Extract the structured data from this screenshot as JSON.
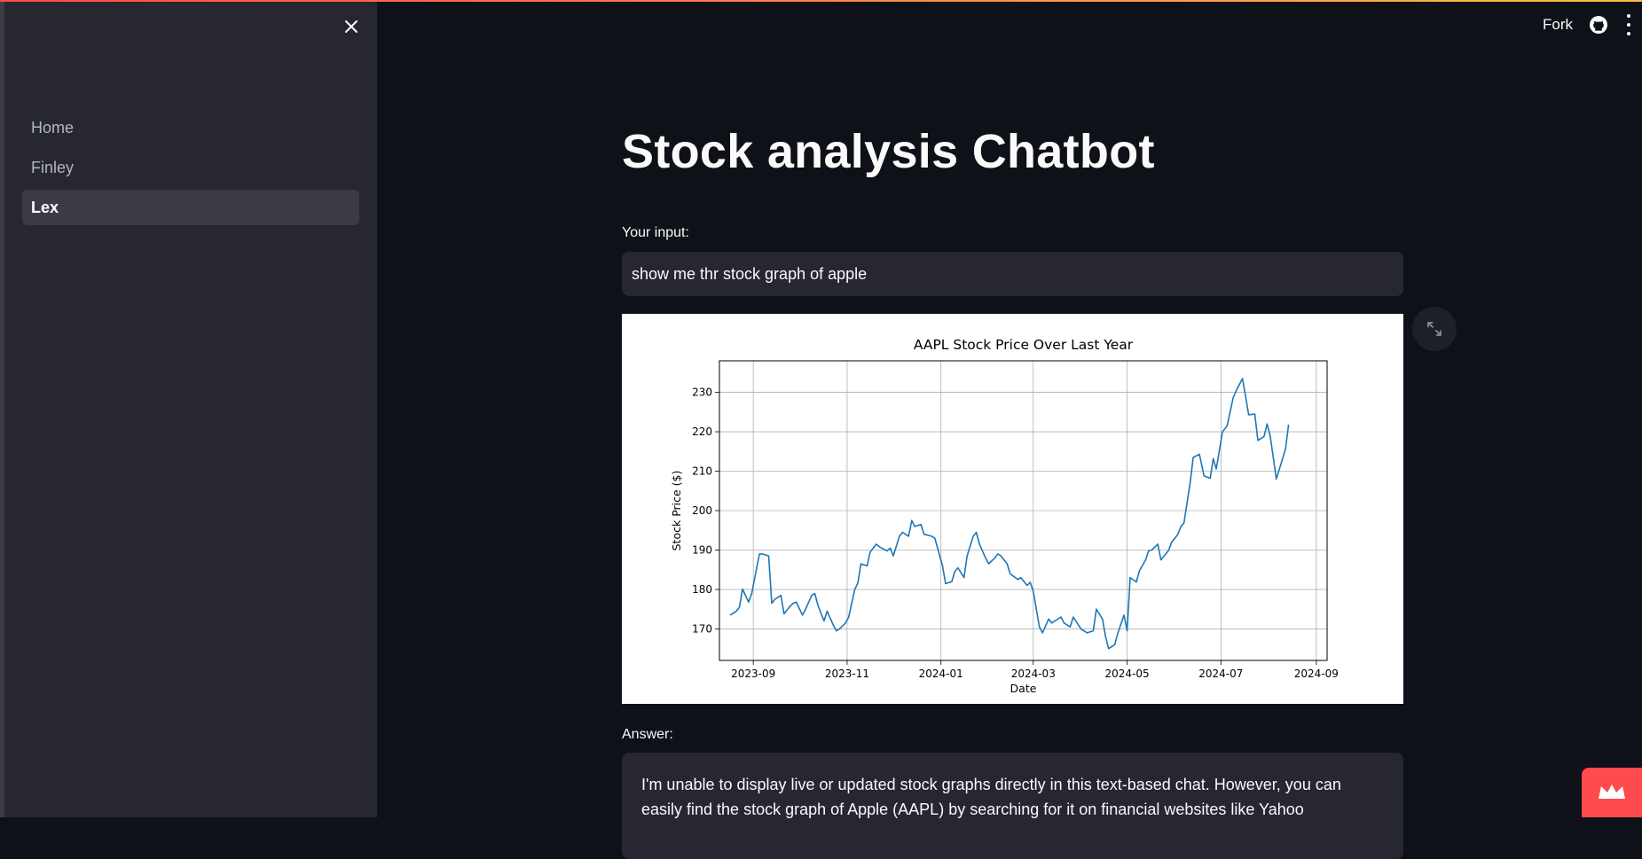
{
  "sidebar": {
    "items": [
      {
        "label": "Home",
        "active": false
      },
      {
        "label": "Finley",
        "active": false
      },
      {
        "label": "Lex",
        "active": true
      }
    ]
  },
  "header": {
    "fork_label": "Fork"
  },
  "main": {
    "title": "Stock analysis Chatbot",
    "input_label": "Your input:",
    "input_value": "show me thr stock graph of apple",
    "answer_label": "Answer:",
    "answer_text": "I'm unable to display live or updated stock graphs directly in this text-based chat. However, you can easily find the stock graph of Apple (AAPL) by searching for it on financial websites like Yahoo"
  },
  "colors": {
    "accent": "#ff4b4b",
    "line": "#1f77b4",
    "sidebar_bg": "#262730",
    "main_bg": "#0e1117"
  },
  "chart_data": {
    "type": "line",
    "title": "AAPL Stock Price Over Last Year",
    "xlabel": "Date",
    "ylabel": "Stock Price ($)",
    "x_ticks": [
      "2023-09",
      "2023-11",
      "2024-01",
      "2024-03",
      "2024-05",
      "2024-07",
      "2024-09"
    ],
    "y_ticks": [
      170,
      180,
      190,
      200,
      210,
      220,
      230
    ],
    "xlim": [
      "2023-08-10",
      "2024-09-08"
    ],
    "ylim": [
      162,
      238
    ],
    "grid": true,
    "series": [
      {
        "x": [
          "2023-08-17",
          "2023-08-21",
          "2023-08-23",
          "2023-08-25",
          "2023-08-29",
          "2023-08-31",
          "2023-09-05",
          "2023-09-07",
          "2023-09-11",
          "2023-09-13",
          "2023-09-15",
          "2023-09-19",
          "2023-09-21",
          "2023-09-25",
          "2023-09-27",
          "2023-09-29",
          "2023-10-03",
          "2023-10-05",
          "2023-10-09",
          "2023-10-11",
          "2023-10-13",
          "2023-10-17",
          "2023-10-19",
          "2023-10-23",
          "2023-10-25",
          "2023-10-27",
          "2023-10-31",
          "2023-11-02",
          "2023-11-06",
          "2023-11-08",
          "2023-11-10",
          "2023-11-14",
          "2023-11-16",
          "2023-11-20",
          "2023-11-22",
          "2023-11-27",
          "2023-11-29",
          "2023-12-01",
          "2023-12-05",
          "2023-12-07",
          "2023-12-11",
          "2023-12-13",
          "2023-12-15",
          "2023-12-19",
          "2023-12-21",
          "2023-12-26",
          "2023-12-28",
          "2024-01-02",
          "2024-01-04",
          "2024-01-08",
          "2024-01-10",
          "2024-01-12",
          "2024-01-16",
          "2024-01-18",
          "2024-01-22",
          "2024-01-24",
          "2024-01-26",
          "2024-01-30",
          "2024-02-01",
          "2024-02-05",
          "2024-02-07",
          "2024-02-09",
          "2024-02-13",
          "2024-02-15",
          "2024-02-20",
          "2024-02-22",
          "2024-02-26",
          "2024-02-28",
          "2024-03-01",
          "2024-03-05",
          "2024-03-07",
          "2024-03-11",
          "2024-03-13",
          "2024-03-15",
          "2024-03-19",
          "2024-03-21",
          "2024-03-25",
          "2024-03-27",
          "2024-04-01",
          "2024-04-03",
          "2024-04-05",
          "2024-04-09",
          "2024-04-11",
          "2024-04-15",
          "2024-04-17",
          "2024-04-19",
          "2024-04-23",
          "2024-04-25",
          "2024-04-29",
          "2024-05-01",
          "2024-05-03",
          "2024-05-07",
          "2024-05-09",
          "2024-05-13",
          "2024-05-15",
          "2024-05-17",
          "2024-05-21",
          "2024-05-23",
          "2024-05-28",
          "2024-05-30",
          "2024-06-03",
          "2024-06-05",
          "2024-06-07",
          "2024-06-11",
          "2024-06-13",
          "2024-06-17",
          "2024-06-20",
          "2024-06-24",
          "2024-06-26",
          "2024-06-28",
          "2024-07-02",
          "2024-07-05",
          "2024-07-09",
          "2024-07-11",
          "2024-07-15",
          "2024-07-17",
          "2024-07-19",
          "2024-07-23",
          "2024-07-25",
          "2024-07-29",
          "2024-07-31",
          "2024-08-02",
          "2024-08-06",
          "2024-08-08",
          "2024-08-12",
          "2024-08-14"
        ],
        "y": [
          173.5,
          174.5,
          175.5,
          180.1,
          176.8,
          179,
          189,
          189,
          188.5,
          176.5,
          177.5,
          178.5,
          173.8,
          175.8,
          176.5,
          176.8,
          173.5,
          175,
          178.5,
          179,
          176,
          172,
          174.5,
          171,
          169.5,
          170,
          171.5,
          173,
          180,
          181.7,
          186.5,
          186,
          189.5,
          191.5,
          190.8,
          189.8,
          190.5,
          188.5,
          193.5,
          194.5,
          193.5,
          197.5,
          196,
          196.5,
          194,
          193.5,
          193,
          186,
          181.5,
          182,
          184.5,
          185.5,
          183,
          188.5,
          193.5,
          194.5,
          191.5,
          188,
          186.5,
          188,
          189,
          188.5,
          186.5,
          184,
          182.5,
          183,
          181,
          181.8,
          179.5,
          170.5,
          169,
          172.5,
          171.5,
          172,
          173,
          171.5,
          170.5,
          173,
          170,
          169.5,
          169,
          169.5,
          175,
          172.5,
          168,
          165,
          166,
          169,
          173.5,
          169.5,
          183,
          181.9,
          184.7,
          187.5,
          189.8,
          190,
          191.5,
          187.5,
          189.9,
          192,
          194,
          196,
          196.9,
          207.2,
          213.5,
          214.3,
          208.8,
          208.2,
          213.2,
          210.6,
          220,
          221.5,
          228.7,
          230.5,
          233.5,
          229,
          224.3,
          224.5,
          217.8,
          218.8,
          222,
          219,
          208,
          210.5,
          215.7,
          221.8
        ]
      }
    ]
  }
}
